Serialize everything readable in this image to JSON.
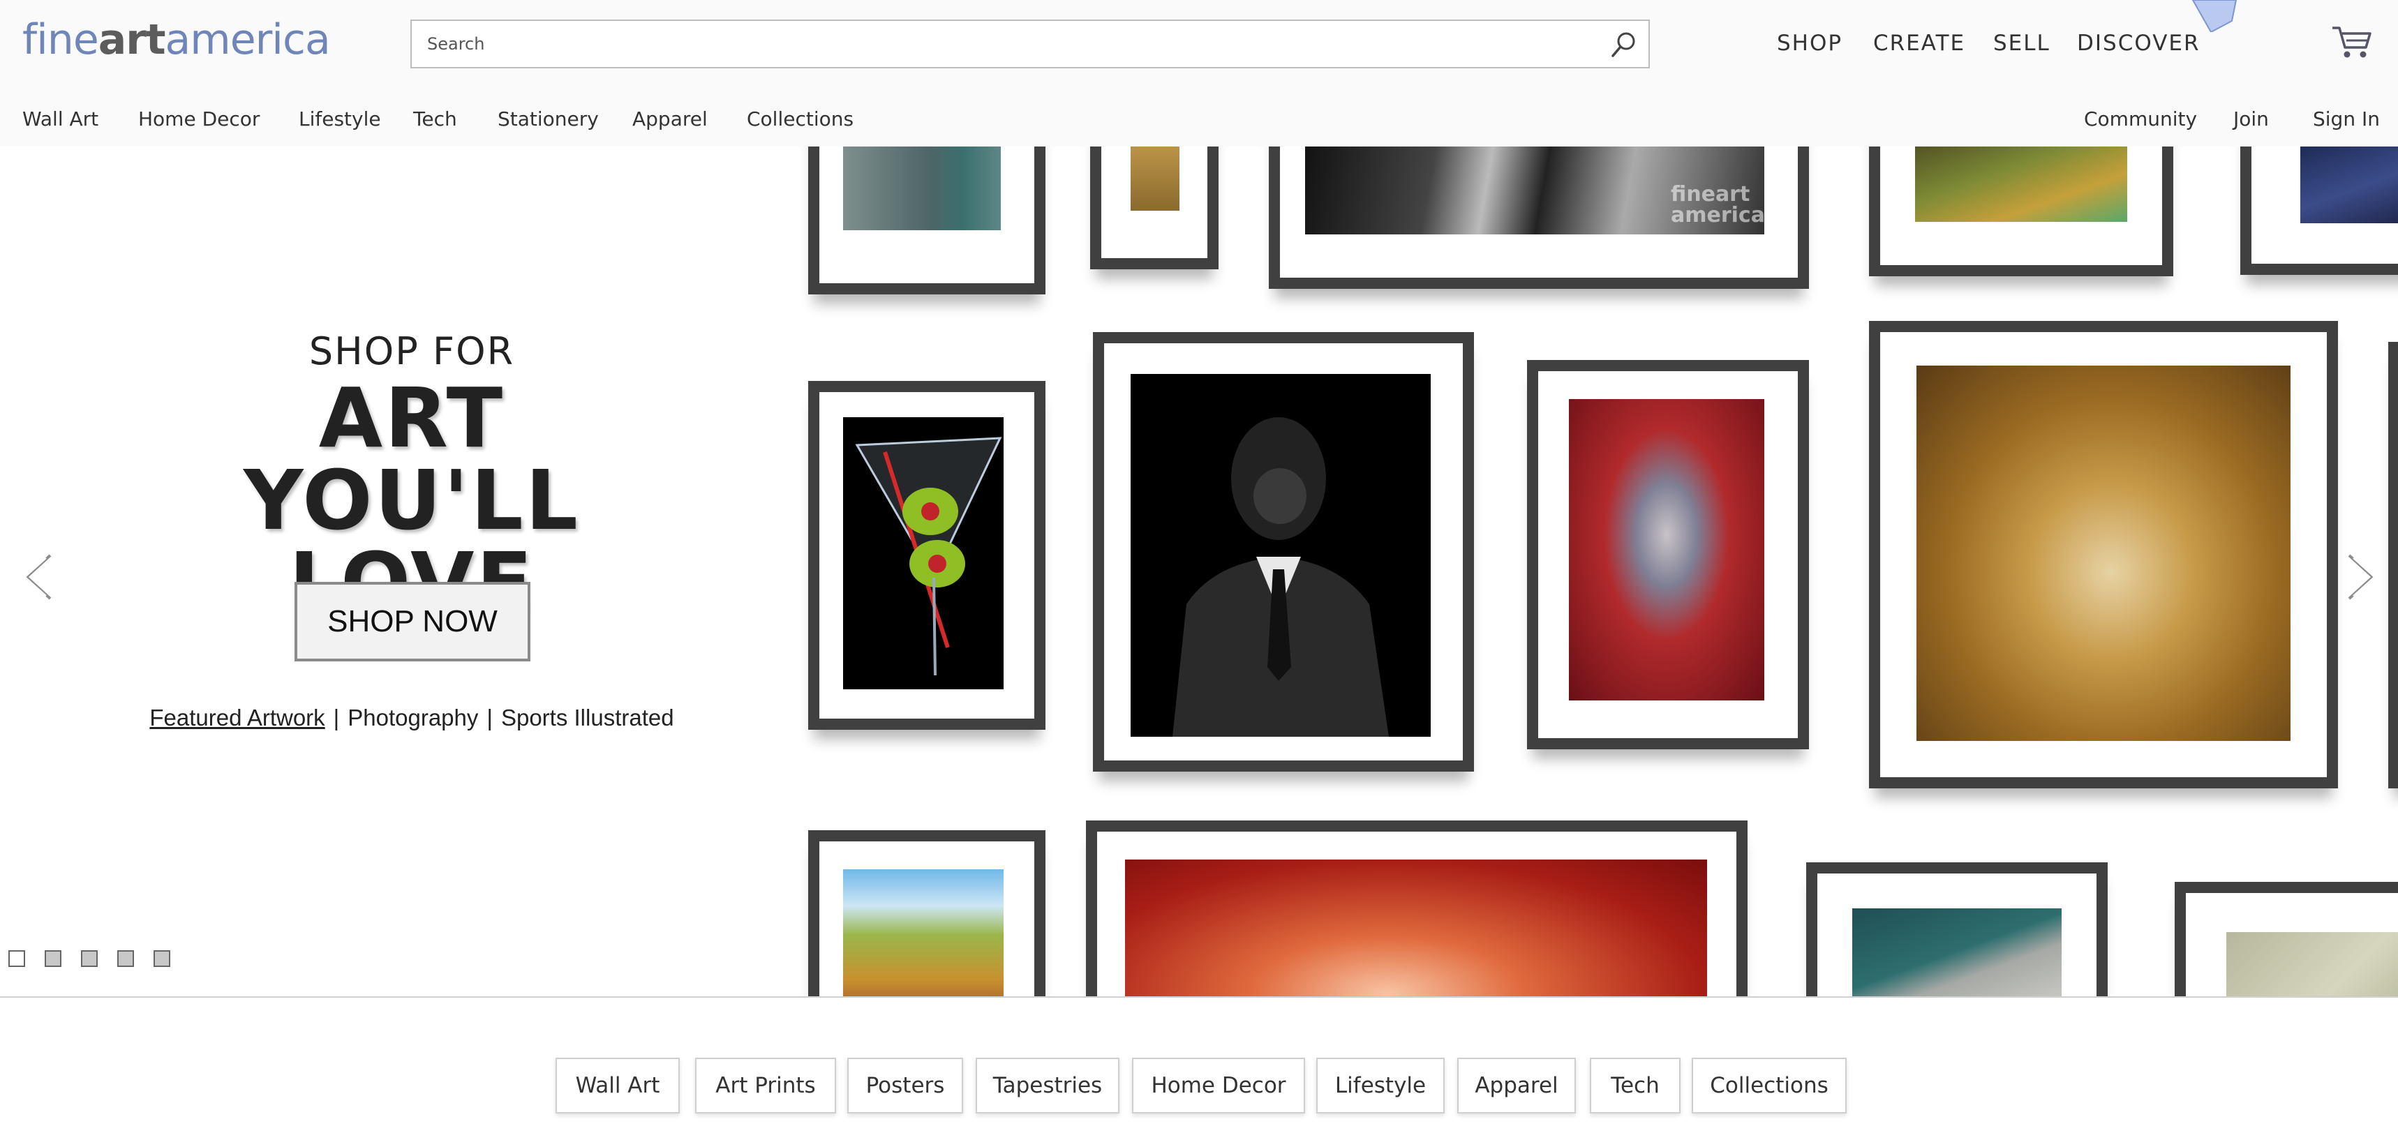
{
  "header": {
    "logo": {
      "part1": "fine",
      "part2": "art",
      "part3": "america"
    },
    "search": {
      "placeholder": "Search"
    },
    "top_nav": [
      "SHOP",
      "CREATE",
      "SELL",
      "DISCOVER"
    ],
    "sub_nav": [
      "Wall Art",
      "Home Decor",
      "Lifestyle",
      "Tech",
      "Stationery",
      "Apparel",
      "Collections"
    ],
    "account_nav": [
      "Community",
      "Join",
      "Sign In"
    ]
  },
  "hero": {
    "kicker": "SHOP FOR",
    "headline_line1": "ART YOU'LL",
    "headline_line2": "LOVE",
    "cta": "SHOP NOW",
    "links": [
      "Featured Artwork",
      "Photography",
      "Sports Illustrated"
    ],
    "separator": "|",
    "slides_total": 5,
    "active_slide": 1,
    "watermark": "fineart america"
  },
  "categories": [
    "Wall Art",
    "Art Prints",
    "Posters",
    "Tapestries",
    "Home Decor",
    "Lifestyle",
    "Apparel",
    "Tech",
    "Collections"
  ],
  "colors": {
    "logo_blue": "#6e86b8",
    "logo_gray": "#5c5c5c",
    "frame": "#404040"
  }
}
